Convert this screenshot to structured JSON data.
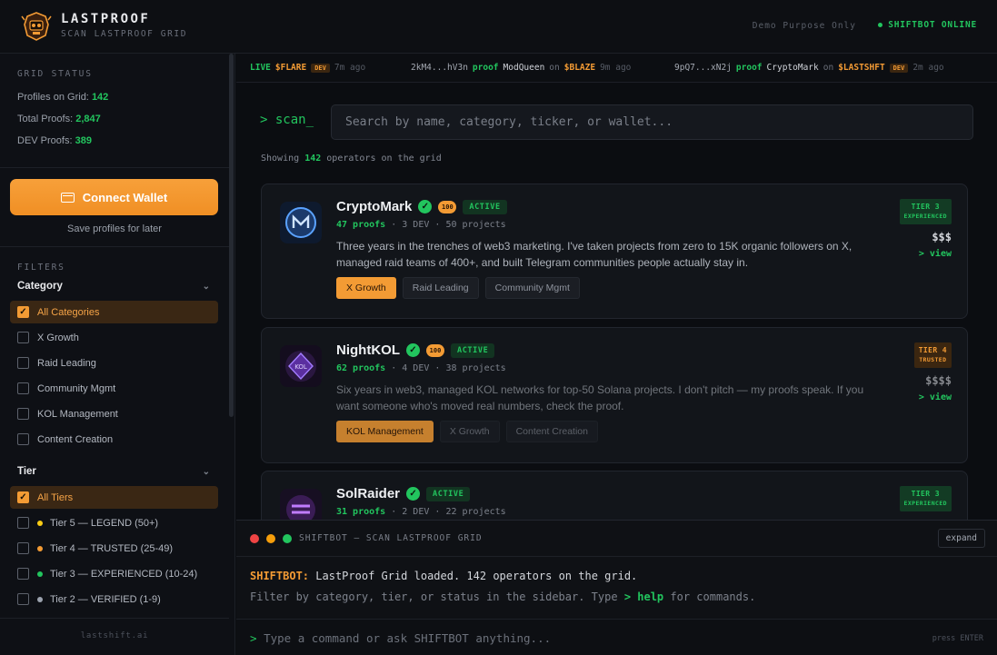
{
  "header": {
    "title": "LASTPROOF",
    "subtitle": "SCAN LASTPROOF GRID",
    "demo_note": "Demo Purpose Only",
    "bot_status": "SHIFTBOT ONLINE",
    "colors": {
      "accent": "#f39b34",
      "online": "#22c55e"
    }
  },
  "sidebar": {
    "grid_status_label": "GRID STATUS",
    "stats": [
      {
        "label": "Profiles on Grid:",
        "value": "142"
      },
      {
        "label": "Total Proofs:",
        "value": "2,847"
      },
      {
        "label": "DEV Proofs:",
        "value": "389"
      }
    ],
    "connect_label": "Connect Wallet",
    "save_note": "Save profiles for later",
    "filters_label": "FILTERS",
    "category": {
      "title": "Category",
      "options": [
        "All Categories",
        "X Growth",
        "Raid Leading",
        "Community Mgmt",
        "KOL Management",
        "Content Creation"
      ]
    },
    "tier": {
      "title": "Tier",
      "all_label": "All Tiers",
      "options": [
        {
          "label": "Tier 5 — LEGEND (50+)",
          "color": "#facc15"
        },
        {
          "label": "Tier 4 — TRUSTED (25-49)",
          "color": "#f39b34"
        },
        {
          "label": "Tier 3 — EXPERIENCED (10-24)",
          "color": "#22c55e"
        },
        {
          "label": "Tier 2 — VERIFIED (1-9)",
          "color": "#9ca3af"
        }
      ]
    },
    "footer": "lastshift.ai"
  },
  "ticker": {
    "live_label": "LIVE",
    "item1": {
      "ticker": "$FLARE",
      "badge": "DEV",
      "ago": "7m ago"
    },
    "item2": {
      "wallet": "2kM4...hV3n",
      "proof": "proof",
      "name": "ModQueen",
      "on": "on",
      "ticker": "$BLAZE",
      "ago": "9m ago"
    },
    "item3": {
      "wallet": "9pQ7...xN2j",
      "proof": "proof",
      "name": "CryptoMark",
      "on": "on",
      "ticker": "$LASTSHFT",
      "badge": "DEV",
      "ago": "2m ago"
    }
  },
  "scan": {
    "prompt": "> scan_",
    "placeholder": "Search by name, category, ticker, or wallet...",
    "showing_pre": "Showing",
    "showing_count": "142",
    "showing_post": "operators on the grid"
  },
  "cards": [
    {
      "name": "CryptoMark",
      "score": "100",
      "status": "ACTIVE",
      "proofs": "47 proofs",
      "dev": "3 DEV",
      "projects": "50 projects",
      "bio": "Three years in the trenches of web3 marketing. I've taken projects from zero to 15K organic followers on X, managed raid teams of 400+, and built Telegram communities people actually stay in.",
      "tags": [
        "X Growth",
        "Raid Leading",
        "Community Mgmt"
      ],
      "tier": "TIER 3",
      "tier_sub": "EXPERIENCED",
      "price": "$$$",
      "view": "> view"
    },
    {
      "name": "NightKOL",
      "score": "100",
      "status": "ACTIVE",
      "proofs": "62 proofs",
      "dev": "4 DEV",
      "projects": "38 projects",
      "bio": "Six years in web3, managed KOL networks for top-50 Solana projects. I don't pitch — my proofs speak. If you want someone who's moved real numbers, check the proof.",
      "tags": [
        "KOL Management",
        "X Growth",
        "Content Creation"
      ],
      "tier": "TIER 4",
      "tier_sub": "TRUSTED",
      "price": "$$$$",
      "view": "> view"
    },
    {
      "name": "SolRaider",
      "status": "ACTIVE",
      "proofs": "31 proofs",
      "dev": "2 DEV",
      "projects": "22 projects",
      "tier": "TIER 3",
      "tier_sub": "EXPERIENCED"
    }
  ],
  "terminal": {
    "title": "SHIFTBOT — SCAN LASTPROOF GRID",
    "expand": "expand",
    "bot_name": "SHIFTBOT:",
    "line1": "LastProof Grid loaded. 142 operators on the grid.",
    "line2_pre": "Filter by category, tier, or status in the sidebar. Type",
    "line2_cmd": "> help",
    "line2_post": "for commands.",
    "cmd_prompt": ">",
    "cmd_placeholder": "Type a command or ask SHIFTBOT anything...",
    "press": "press ENTER"
  }
}
